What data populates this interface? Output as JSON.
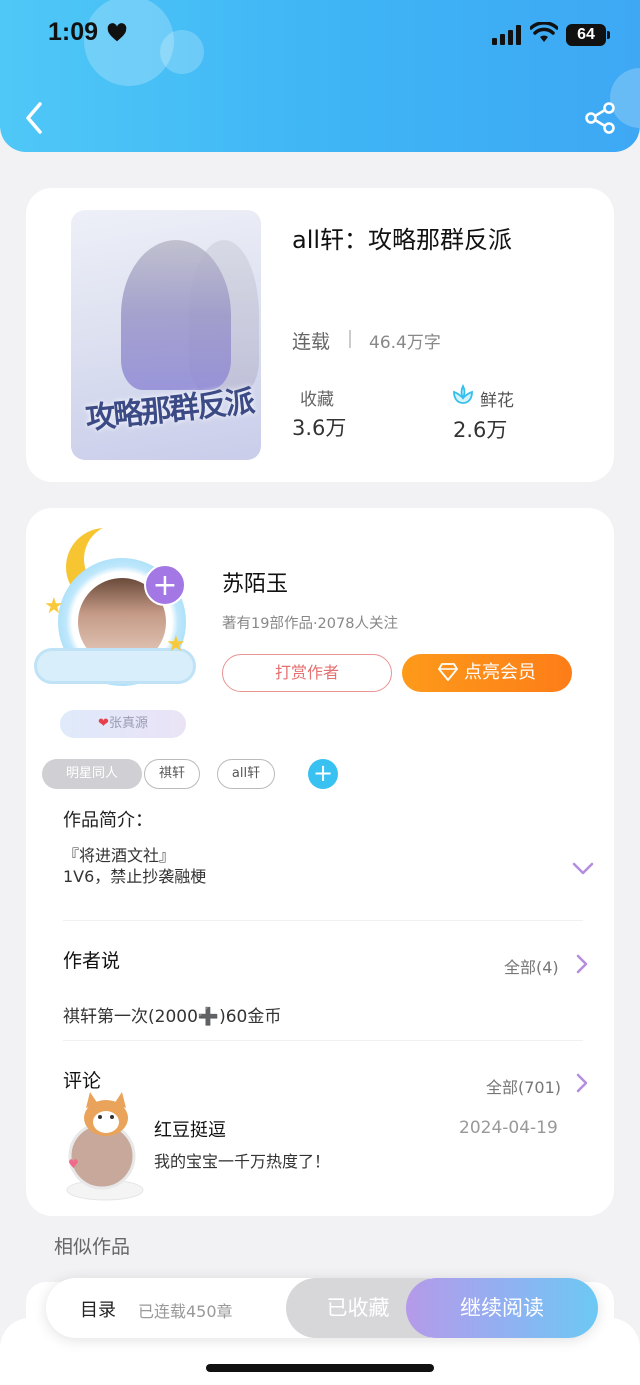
{
  "status_bar": {
    "time": "1:09",
    "battery": "64"
  },
  "book": {
    "title": "all轩：攻略那群反派",
    "cover_title": "攻略那群反派",
    "status": "连载",
    "word_count": "46.4万字",
    "collect_label": "收藏",
    "collect_value": "3.6万",
    "flower_label": "鲜花",
    "flower_value": "2.6万"
  },
  "author": {
    "name": "苏陌玉",
    "stats": "著有19部作品·2078人关注",
    "fan_tag": "张真源",
    "tip_button": "打赏作者",
    "vip_button": "点亮会员"
  },
  "tags": [
    "明星同人",
    "祺轩",
    "all轩"
  ],
  "intro": {
    "title": "作品简介：",
    "lines": [
      "『将进酒文社』",
      "1V6，禁止抄袭融梗"
    ]
  },
  "author_says": {
    "title": "作者说",
    "see_all": "全部(4)",
    "text": "祺轩第一次(2000➕)60金币"
  },
  "comments": {
    "title": "评论",
    "see_all": "全部(701)",
    "items": [
      {
        "user": "红豆挺逗",
        "date": "2024-04-19",
        "text": "我的宝宝一千万热度了！"
      }
    ]
  },
  "similar": {
    "title": "相似作品"
  },
  "bottom_bar": {
    "toc": "目录",
    "serial": "已连载450章",
    "collected": "已收藏",
    "continue": "继续阅读"
  },
  "colors": {
    "header_gradient": [
      "#4fc8f7",
      "#3ea8f4"
    ],
    "vip_orange": "#fd8a1a",
    "tip_red": "#e57070",
    "tag_add_blue": "#39c1f1",
    "accent_purple": "#a377e4"
  }
}
